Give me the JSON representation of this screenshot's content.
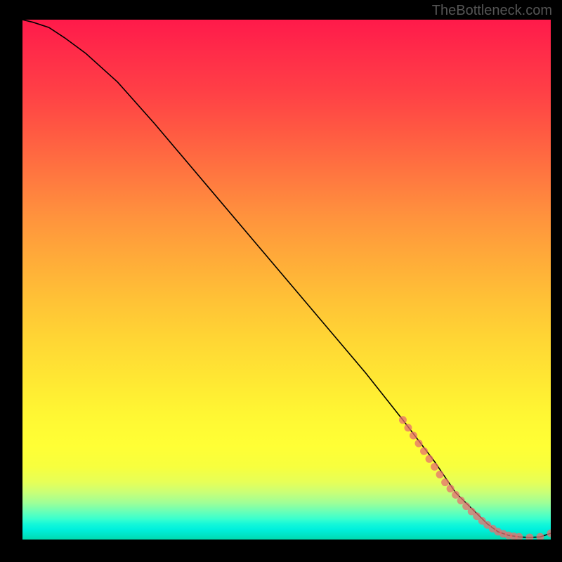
{
  "watermark": "TheBottleneck.com",
  "chart_data": {
    "type": "line",
    "title": "",
    "xlabel": "",
    "ylabel": "",
    "xlim": [
      0,
      100
    ],
    "ylim": [
      0,
      100
    ],
    "grid": false,
    "background": "rainbow-gradient-vertical",
    "series": [
      {
        "name": "curve",
        "type": "line",
        "color": "#000000",
        "x": [
          0,
          2,
          5,
          8,
          12,
          18,
          25,
          35,
          45,
          55,
          65,
          72,
          78,
          82,
          86,
          88,
          90,
          92,
          94,
          96,
          98,
          100
        ],
        "y": [
          100,
          99.5,
          98.5,
          96.5,
          93.5,
          88,
          80,
          68,
          56,
          44,
          32,
          23,
          15,
          9,
          5,
          3,
          1.5,
          0.8,
          0.5,
          0.4,
          0.5,
          1.2
        ]
      },
      {
        "name": "highlighted-points",
        "type": "scatter",
        "color": "#e76f6f",
        "x": [
          72,
          73,
          74,
          75,
          76,
          77,
          78,
          79,
          80,
          81,
          82,
          83,
          84,
          85,
          86,
          87,
          88,
          89,
          90,
          91,
          92,
          93,
          94,
          96,
          98,
          100
        ],
        "y": [
          23,
          21.5,
          20,
          18.5,
          17,
          15.5,
          14,
          12.5,
          11,
          9.8,
          8.6,
          7.5,
          6.4,
          5.4,
          4.5,
          3.6,
          2.8,
          2.1,
          1.5,
          1.1,
          0.8,
          0.6,
          0.5,
          0.4,
          0.5,
          1.2
        ]
      }
    ]
  },
  "colors": {
    "background": "#000000",
    "curve": "#000000",
    "points": "#e76f6f",
    "watermark": "#555555"
  }
}
